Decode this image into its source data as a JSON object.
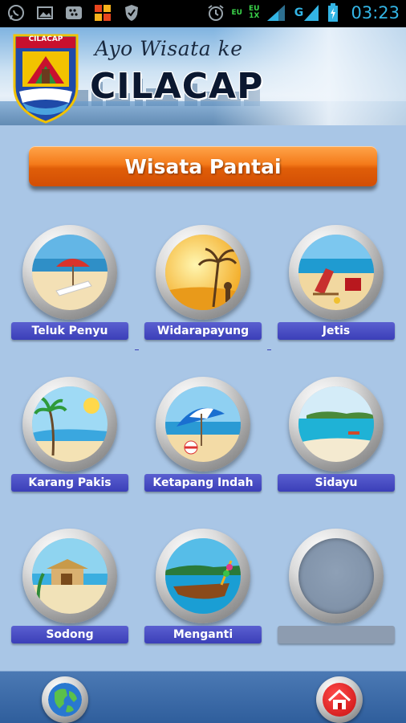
{
  "status_bar": {
    "time": "03:23",
    "network_top": "EU",
    "network_mid": "EU",
    "network_bottom": "1X",
    "signal_label": "G",
    "icons": [
      "whatsapp-icon",
      "gallery-icon",
      "blackberry-icon",
      "windows-icon",
      "shield-icon",
      "alarm-icon",
      "signal-icon",
      "battery-icon"
    ]
  },
  "header": {
    "crest_label": "CILACAP",
    "tagline": "Ayo Wisata ke",
    "city": "CILACAP"
  },
  "title": "Wisata Pantai",
  "items": [
    {
      "label": "Teluk Penyu"
    },
    {
      "label": "Widarapayung"
    },
    {
      "label": "Jetis"
    },
    {
      "label": "Karang Pakis"
    },
    {
      "label": "Ketapang Indah"
    },
    {
      "label": "Sidayu"
    },
    {
      "label": "Sodong"
    },
    {
      "label": "Menganti"
    },
    {
      "label": ""
    }
  ],
  "bottom_bar": {
    "left_icon": "globe-icon",
    "right_icon": "home-icon"
  },
  "colors": {
    "background": "#a9c6e6",
    "title_orange": "#f47a1a",
    "label_blue": "#3b3fb8",
    "bottom_bar": "#2f5e9c"
  }
}
